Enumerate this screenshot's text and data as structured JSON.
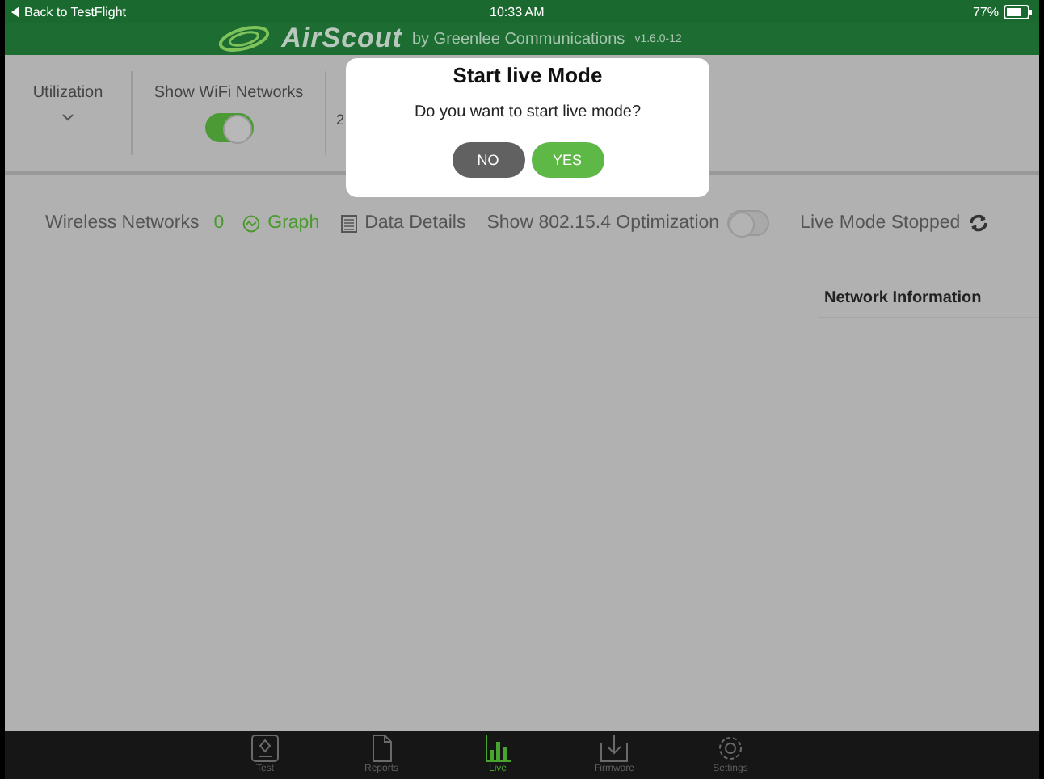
{
  "status_bar": {
    "back": "Back to TestFlight",
    "time": "10:33 AM",
    "battery": "77%"
  },
  "header": {
    "app_name": "AirScout",
    "by": "by Greenlee Communications",
    "version": "v1.6.0-12"
  },
  "toolbar": {
    "utilization": "Utilization",
    "show_wifi": {
      "label": "Show WiFi Networks",
      "on": true
    },
    "column_3": "2"
  },
  "filter_bar": {
    "wireless_label": "Wireless Networks",
    "wireless_count": "0",
    "views": [
      {
        "label": "Graph",
        "kind": "graph",
        "selected": true
      },
      {
        "label": "Data Details",
        "kind": "details",
        "selected": false
      }
    ],
    "optimization": {
      "label": "Show 802.15.4 Optimization",
      "on": false
    },
    "live_status": "Live Mode Stopped"
  },
  "side_panel": {
    "title": "Network Information"
  },
  "dialog": {
    "title": "Start live Mode",
    "message": "Do you want to start live mode?",
    "buttons": [
      {
        "label": "NO",
        "kind": "cancel"
      },
      {
        "label": "YES",
        "kind": "confirm"
      }
    ]
  },
  "tab_bar": [
    {
      "label": "Test",
      "kind": "test",
      "selected": false
    },
    {
      "label": "Reports",
      "kind": "reports",
      "selected": false
    },
    {
      "label": "Live",
      "kind": "live",
      "selected": true
    },
    {
      "label": "Firmware",
      "kind": "firmware",
      "selected": false
    },
    {
      "label": "Settings",
      "kind": "settings",
      "selected": false
    }
  ]
}
